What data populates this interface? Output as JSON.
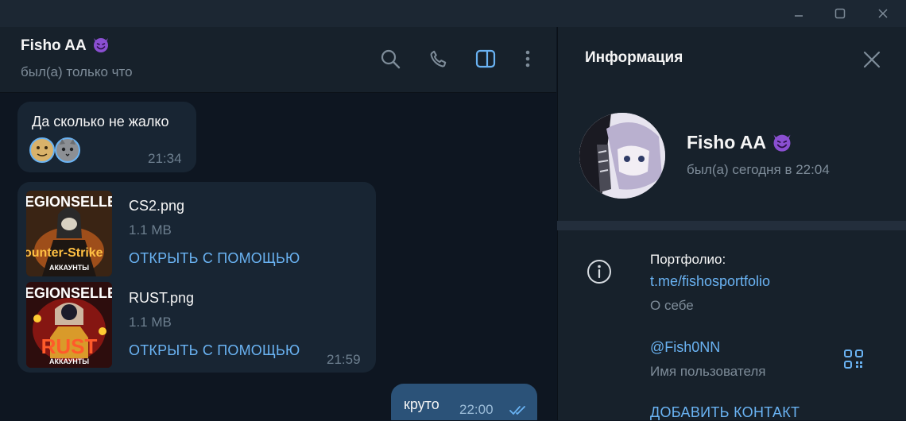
{
  "window": {
    "minimize_icon": "minimize-icon",
    "maximize_icon": "maximize-icon",
    "close_icon": "close-icon"
  },
  "chat_header": {
    "name": "Fisho AA",
    "name_emoji": "smiling-devil-emoji",
    "status": "был(а) только что",
    "icons": [
      "search-icon",
      "phone-icon",
      "sidebar-toggle-icon",
      "more-vertical-icon"
    ]
  },
  "messages": [
    {
      "direction": "in",
      "text": "Да сколько не жалко",
      "stickers": [
        "face-emoji",
        "cat-emoji"
      ],
      "time": "21:34"
    },
    {
      "direction": "in",
      "files": [
        {
          "thumb_text_top": "EGIONSELLE",
          "thumb_text_bottom": "ounter-Strike",
          "thumb_caption": "АККАУНТЫ",
          "name": "CS2.png",
          "size": "1.1 MB",
          "action": "ОТКРЫТЬ С ПОМОЩЬЮ"
        },
        {
          "thumb_text_top": "EGIONSELLE",
          "thumb_text_bottom": "RUST",
          "thumb_caption": "АККАУНТЫ",
          "name": "RUST.png",
          "size": "1.1 MB",
          "action": "ОТКРЫТЬ С ПОМОЩЬЮ"
        }
      ],
      "time": "21:59"
    },
    {
      "direction": "out",
      "text": "круто",
      "time": "22:00",
      "status_icon": "double-check-icon"
    }
  ],
  "info_panel": {
    "title": "Информация",
    "close_icon": "close-icon",
    "name": "Fisho AA",
    "status": "был(а) сегодня в 22:04",
    "bio_label": "Портфолио:",
    "bio_link": "t.me/fishosportfolio",
    "bio_sub": "О себе",
    "username": "@Fish0NN",
    "username_sub": "Имя пользователя",
    "add_contact": "ДОБАВИТЬ КОНТАКТ",
    "info_icon": "info-icon",
    "qr_icon": "qr-code-icon"
  },
  "colors": {
    "background": "#0e1621",
    "panel": "#17212b",
    "bubble_in": "#182533",
    "bubble_out": "#2b5278",
    "accent": "#6ab3f3",
    "muted": "#7e8c99"
  }
}
